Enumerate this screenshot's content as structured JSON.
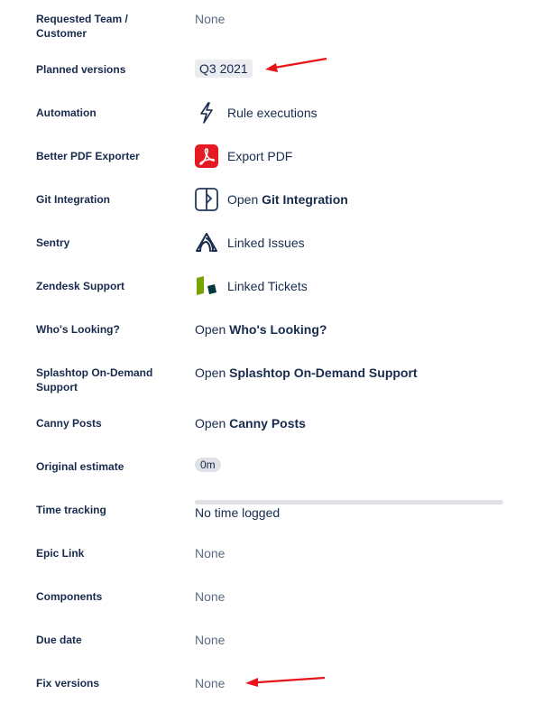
{
  "fields": [
    {
      "label": "Requested Team / Customer",
      "value": "None"
    },
    {
      "label": "Planned versions",
      "value": "Q3 2021"
    },
    {
      "label": "Automation",
      "value": "Rule executions",
      "icon": "lightning-icon"
    },
    {
      "label": "Better PDF Exporter",
      "value": "Export PDF",
      "icon": "pdf-icon"
    },
    {
      "label": "Git Integration",
      "prefix": "Open ",
      "bold": "Git Integration",
      "icon": "git-integration-icon"
    },
    {
      "label": "Sentry",
      "value": "Linked Issues",
      "icon": "sentry-icon"
    },
    {
      "label": "Zendesk Support",
      "value": "Linked Tickets",
      "icon": "zendesk-icon"
    },
    {
      "label": "Who's Looking?",
      "prefix": "Open ",
      "bold": "Who's Looking?"
    },
    {
      "label": "Splashtop On-Demand Support",
      "prefix": "Open ",
      "bold": "Splashtop On-Demand Support"
    },
    {
      "label": "Canny Posts",
      "prefix": "Open ",
      "bold": "Canny Posts"
    },
    {
      "label": "Original estimate",
      "value": "0m"
    },
    {
      "label": "Time tracking",
      "value": "No time logged"
    },
    {
      "label": "Epic Link",
      "value": "None"
    },
    {
      "label": "Components",
      "value": "None"
    },
    {
      "label": "Due date",
      "value": "None"
    },
    {
      "label": "Fix versions",
      "value": "None"
    }
  ],
  "colors": {
    "annotation_arrow": "#e8141a",
    "pdf_red": "#e51b24",
    "zendesk_green": "#78a300",
    "zendesk_dark": "#03363d"
  }
}
